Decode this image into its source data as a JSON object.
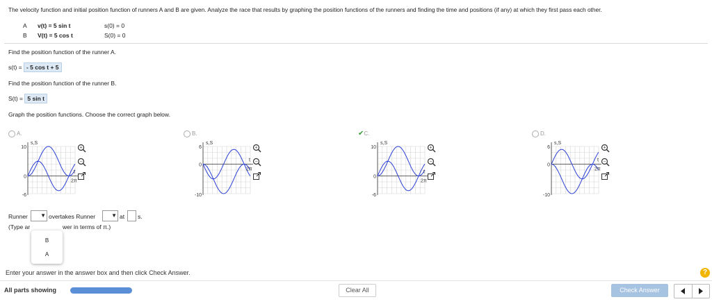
{
  "question": {
    "prompt": "The velocity function and initial position function of runners A and B are given. Analyze the race that results by graphing the position functions of the runners and finding the time and positions (if any) at which they first pass each other.",
    "runners": [
      {
        "label": "A",
        "velocity": "v(t) = 5 sin t",
        "initial": "s(0) = 0"
      },
      {
        "label": "B",
        "velocity": "V(t) = 5 cos t",
        "initial": "S(0) = 0"
      }
    ]
  },
  "part1": {
    "prompt": "Find the position function of the runner A.",
    "lhs": "s(t) =",
    "answer": "- 5 cos t + 5"
  },
  "part2": {
    "prompt": "Find the position function of the runner B.",
    "lhs": "S(t) =",
    "answer": "5 sin t"
  },
  "part3": {
    "prompt": "Graph the position functions. Choose the correct graph below.",
    "options": [
      {
        "label": "A.",
        "selected": false,
        "y_ticks": [
          "10",
          "0",
          "-6"
        ],
        "axis_label": "s,S",
        "x_label": "t",
        "x_tick": "2π"
      },
      {
        "label": "B.",
        "selected": false,
        "y_ticks": [
          "6",
          "0",
          "-10"
        ],
        "axis_label": "s,S",
        "x_label": "t",
        "x_tick": "2π"
      },
      {
        "label": "C.",
        "selected": true,
        "y_ticks": [
          "10",
          "0",
          "-6"
        ],
        "axis_label": "s,S",
        "x_label": "t",
        "x_tick": "2π"
      },
      {
        "label": "D.",
        "selected": false,
        "y_ticks": [
          "6",
          "0",
          "-10"
        ],
        "axis_label": "s,S",
        "x_label": "t",
        "x_tick": "2π"
      }
    ]
  },
  "part4": {
    "runner_label": "Runner",
    "overtakes_label": "overtakes Runner",
    "at_label": "at",
    "units": "s.",
    "hint_prefix": "(Type ar",
    "hint_suffix": "wer in terms of π.)",
    "dropdown_options": [
      "B",
      "A"
    ]
  },
  "footer": {
    "instruction": "Enter your answer in the answer box and then click Check Answer.",
    "all_parts": "All parts showing",
    "progress": 1.0,
    "clear_all": "Clear All",
    "check_answer": "Check Answer",
    "help": "?"
  }
}
